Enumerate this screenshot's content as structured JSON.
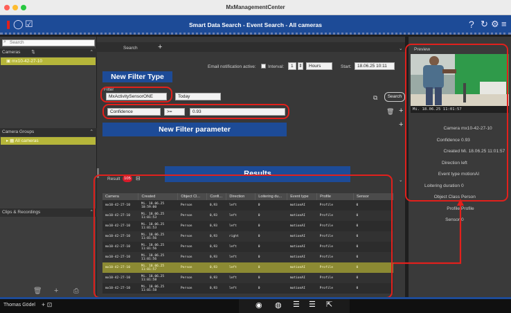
{
  "app": {
    "title": "MxManagementCenter"
  },
  "header": {
    "title": "Smart Data Search - Event Search - All cameras"
  },
  "sidebar": {
    "search_placeholder": "Search",
    "cameras_label": "Cameras",
    "camera_item": "mx10-42-27-10",
    "groups_label": "Camera Groups",
    "groups_item": "All cameras",
    "clips_label": "Clips & Recordings"
  },
  "search_tab": "Search",
  "email": {
    "label": "Email notification active:",
    "interval_label": "Interval:",
    "interval_value": "1",
    "unit": "Hours",
    "start_label": "Start:",
    "start_value": "18.06.25 10:11"
  },
  "filter": {
    "label": "Filter",
    "sensor": "MxActivitySensorONE",
    "period": "Today",
    "param": "Confidence",
    "operator": ">=",
    "value": "0.93",
    "search_button": "Search"
  },
  "callouts": {
    "filter_type": "New Filter Type",
    "filter_param": "New Filter parameter",
    "results": "Results"
  },
  "results": {
    "label": "Result",
    "count": "105",
    "columns": [
      "Camera",
      "Created",
      "Object Cl...",
      "Confi...",
      "Direction",
      "Loitering du...",
      "Event type",
      "Profile",
      "Sensor"
    ],
    "rows": [
      [
        "mx10-42-27-10",
        "Mi. 18.06.25\n10:59:00",
        "Person",
        "0,93",
        "left",
        "0",
        "motionAI",
        "Profile",
        "0"
      ],
      [
        "mx10-42-27-10",
        "Mi. 18.06.25\n11:01:53",
        "Person",
        "0,93",
        "left",
        "0",
        "motionAI",
        "Profile",
        "0"
      ],
      [
        "mx10-42-27-10",
        "Mi. 18.06.25\n11:01:53",
        "Person",
        "0,93",
        "left",
        "0",
        "motionAI",
        "Profile",
        "0"
      ],
      [
        "mx10-42-27-10",
        "Mi. 18.06.25\n11:01:56",
        "Person",
        "0,93",
        "right",
        "0",
        "motionAI",
        "Profile",
        "0"
      ],
      [
        "mx10-42-27-10",
        "Mi. 18.06.25\n11:01:56",
        "Person",
        "0,93",
        "left",
        "0",
        "motionAI",
        "Profile",
        "0"
      ],
      [
        "mx10-42-27-10",
        "Mi. 18.06.25\n11:01:56",
        "Person",
        "0,93",
        "left",
        "0",
        "motionAI",
        "Profile",
        "0"
      ],
      [
        "mx10-42-27-10",
        "Mi. 18.06.25\n11:01:57",
        "Person",
        "0,93",
        "left",
        "0",
        "motionAI",
        "Profile",
        "0"
      ],
      [
        "mx10-42-27-10",
        "Mi. 18.06.25\n11:01:58",
        "Person",
        "0,93",
        "left",
        "0",
        "motionAI",
        "Profile",
        "0"
      ],
      [
        "mx10-42-27-10",
        "Mi. 18.06.25\n11:01:58",
        "Person",
        "0,93",
        "left",
        "0",
        "motionAI",
        "Profile",
        "0"
      ]
    ],
    "selected_row": 6
  },
  "preview": {
    "label": "Preview",
    "timestamp": "Mi. 18.06.25 11:01:57",
    "props": [
      [
        "Camera",
        "mx10-42-27-10"
      ],
      [
        "Confidence",
        "0.93"
      ],
      [
        "Created",
        "Mi. 18.06.25 11:01:57"
      ],
      [
        "Direction",
        "left"
      ],
      [
        "Event type",
        "motionAI"
      ],
      [
        "Loitering duration",
        "0"
      ],
      [
        "Object Class",
        "Person"
      ],
      [
        "Profile",
        "Profile"
      ],
      [
        "Sensor",
        "0"
      ]
    ]
  },
  "bottom": {
    "user": "Thomas Gödel"
  },
  "colors": {
    "accent": "#1d4b97",
    "highlight": "#b6b63a",
    "annotation": "#e2201c"
  }
}
